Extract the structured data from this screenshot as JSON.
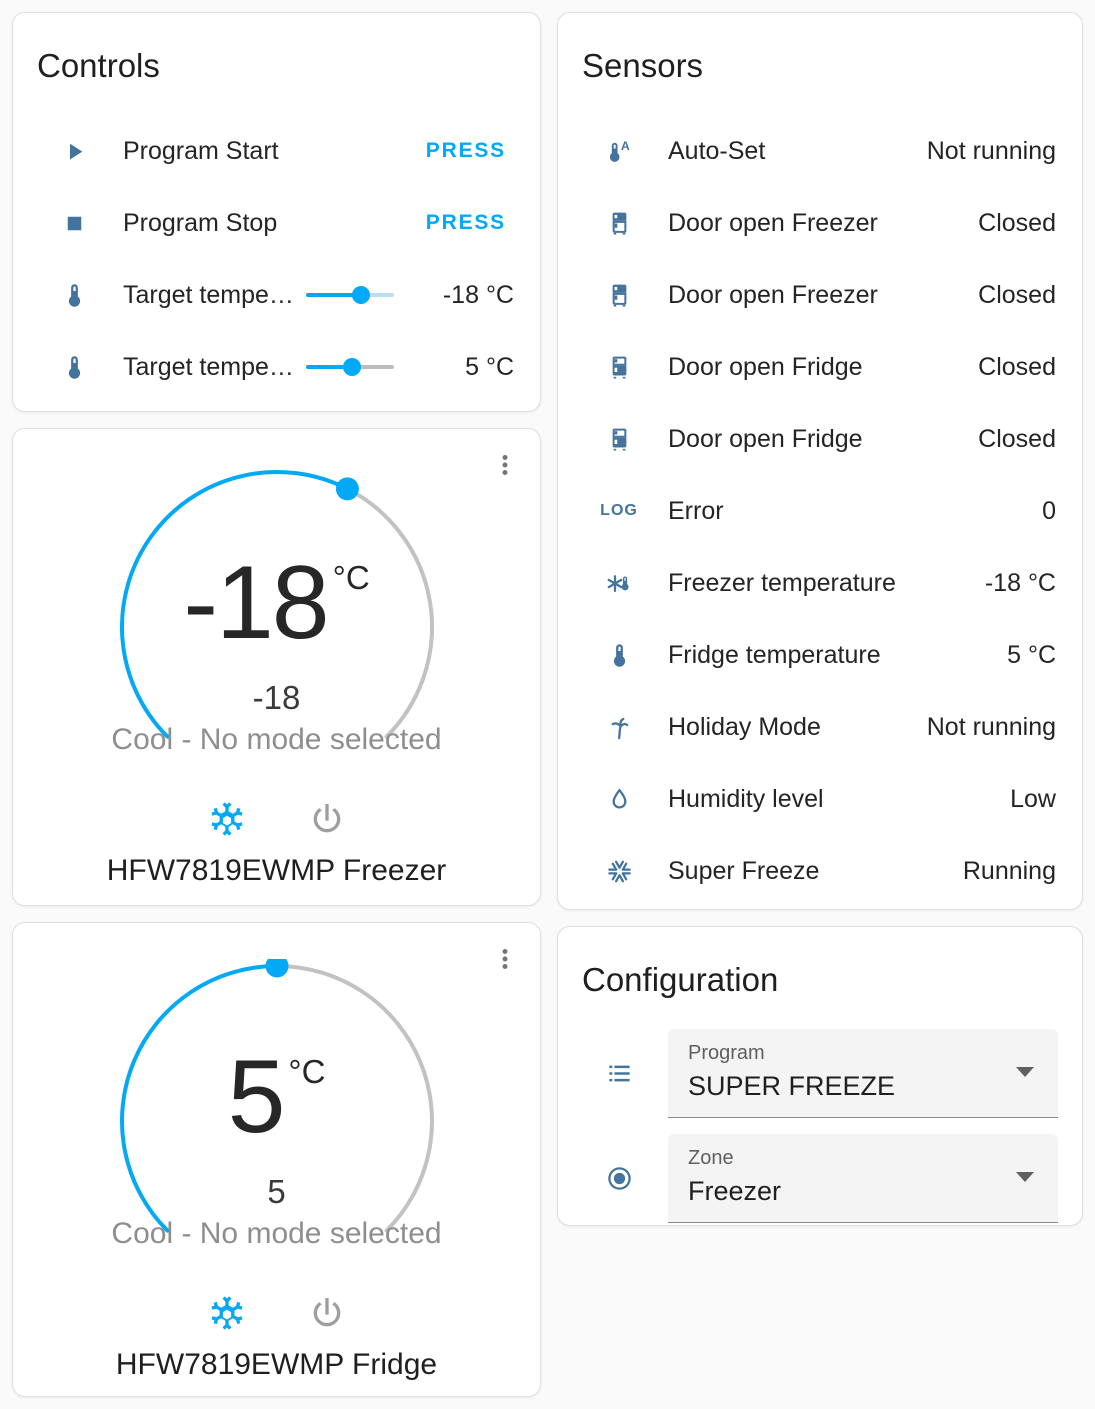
{
  "colors": {
    "accent": "#03a9f4",
    "press": "#03a9f4",
    "icon": "#44739e",
    "remainder_light": "#b7e0f8",
    "remainder_gray": "#bdbdbd",
    "dial_inactive": "#c2c2c2",
    "secondary_text": "#8e8e8e"
  },
  "controls": {
    "title": "Controls",
    "rows": [
      {
        "icon": "play-icon",
        "label": "Program Start",
        "action": "PRESS"
      },
      {
        "icon": "stop-icon",
        "label": "Program Stop",
        "action": "PRESS"
      },
      {
        "icon": "thermometer-icon",
        "label": "Target temperatur…",
        "value": "-18 °C",
        "slider_percent": 63
      },
      {
        "icon": "thermometer-icon",
        "label": "Target temperatur…",
        "value": "5 °C",
        "slider_percent": 52
      }
    ]
  },
  "sensors": {
    "title": "Sensors",
    "rows": [
      {
        "icon": "thermometer-auto-icon",
        "label": "Auto-Set",
        "value": "Not running"
      },
      {
        "icon": "fridge-top-icon",
        "label": "Door open Freezer",
        "value": "Closed"
      },
      {
        "icon": "fridge-top-icon",
        "label": "Door open Freezer",
        "value": "Closed"
      },
      {
        "icon": "fridge-bottom-icon",
        "label": "Door open Fridge",
        "value": "Closed"
      },
      {
        "icon": "fridge-bottom-icon",
        "label": "Door open Fridge",
        "value": "Closed"
      },
      {
        "icon": "log-icon",
        "label": "Error",
        "value": "0"
      },
      {
        "icon": "snowflake-thermometer-icon",
        "label": "Freezer temperature",
        "value": "-18 °C"
      },
      {
        "icon": "thermometer-icon",
        "label": "Fridge temperature",
        "value": "5 °C"
      },
      {
        "icon": "palm-tree-icon",
        "label": "Holiday Mode",
        "value": "Not running"
      },
      {
        "icon": "water-drop-icon",
        "label": "Humidity level",
        "value": "Low"
      },
      {
        "icon": "snowflake-icon",
        "label": "Super Freeze",
        "value": "Running"
      }
    ]
  },
  "thermostats": [
    {
      "name": "HFW7819EWMP Freezer",
      "target": "-18",
      "unit": "°C",
      "current": "-18",
      "mode_text": "Cool - No mode selected",
      "knob_fraction": 0.6,
      "modes": [
        "cool",
        "off"
      ],
      "active_mode": "cool"
    },
    {
      "name": "HFW7819EWMP Fridge",
      "target": "5",
      "unit": "°C",
      "current": "5",
      "mode_text": "Cool - No mode selected",
      "knob_fraction": 0.5,
      "modes": [
        "cool",
        "off"
      ],
      "active_mode": "cool"
    }
  ],
  "configuration": {
    "title": "Configuration",
    "fields": [
      {
        "icon": "list-icon",
        "label": "Program",
        "value": "SUPER FREEZE"
      },
      {
        "icon": "radiobox-icon",
        "label": "Zone",
        "value": "Freezer"
      }
    ]
  }
}
